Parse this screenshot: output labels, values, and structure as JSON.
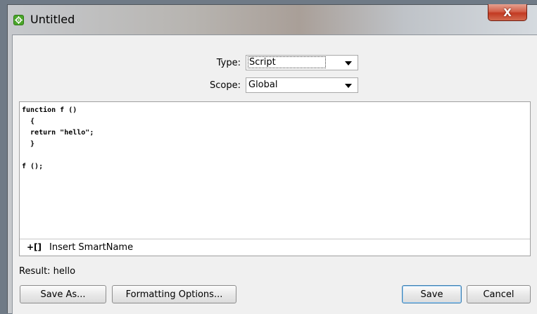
{
  "window": {
    "title": "Untitled",
    "close_glyph": "X"
  },
  "form": {
    "type_label": "Type:",
    "type_value": "Script",
    "scope_label": "Scope:",
    "scope_value": "Global"
  },
  "editor": {
    "code": "function f ()\n  {\n  return \"hello\";\n  }\n\nf ();"
  },
  "smartname": {
    "icon_text": "+[]",
    "label": "Insert SmartName"
  },
  "result": {
    "text": "Result: hello"
  },
  "buttons": {
    "save_as": "Save As...",
    "formatting": "Formatting Options...",
    "save": "Save",
    "cancel": "Cancel"
  },
  "colors": {
    "app_icon": "#4aa62a",
    "close_button": "#c23a22",
    "default_button_border": "#3c7fb1"
  }
}
